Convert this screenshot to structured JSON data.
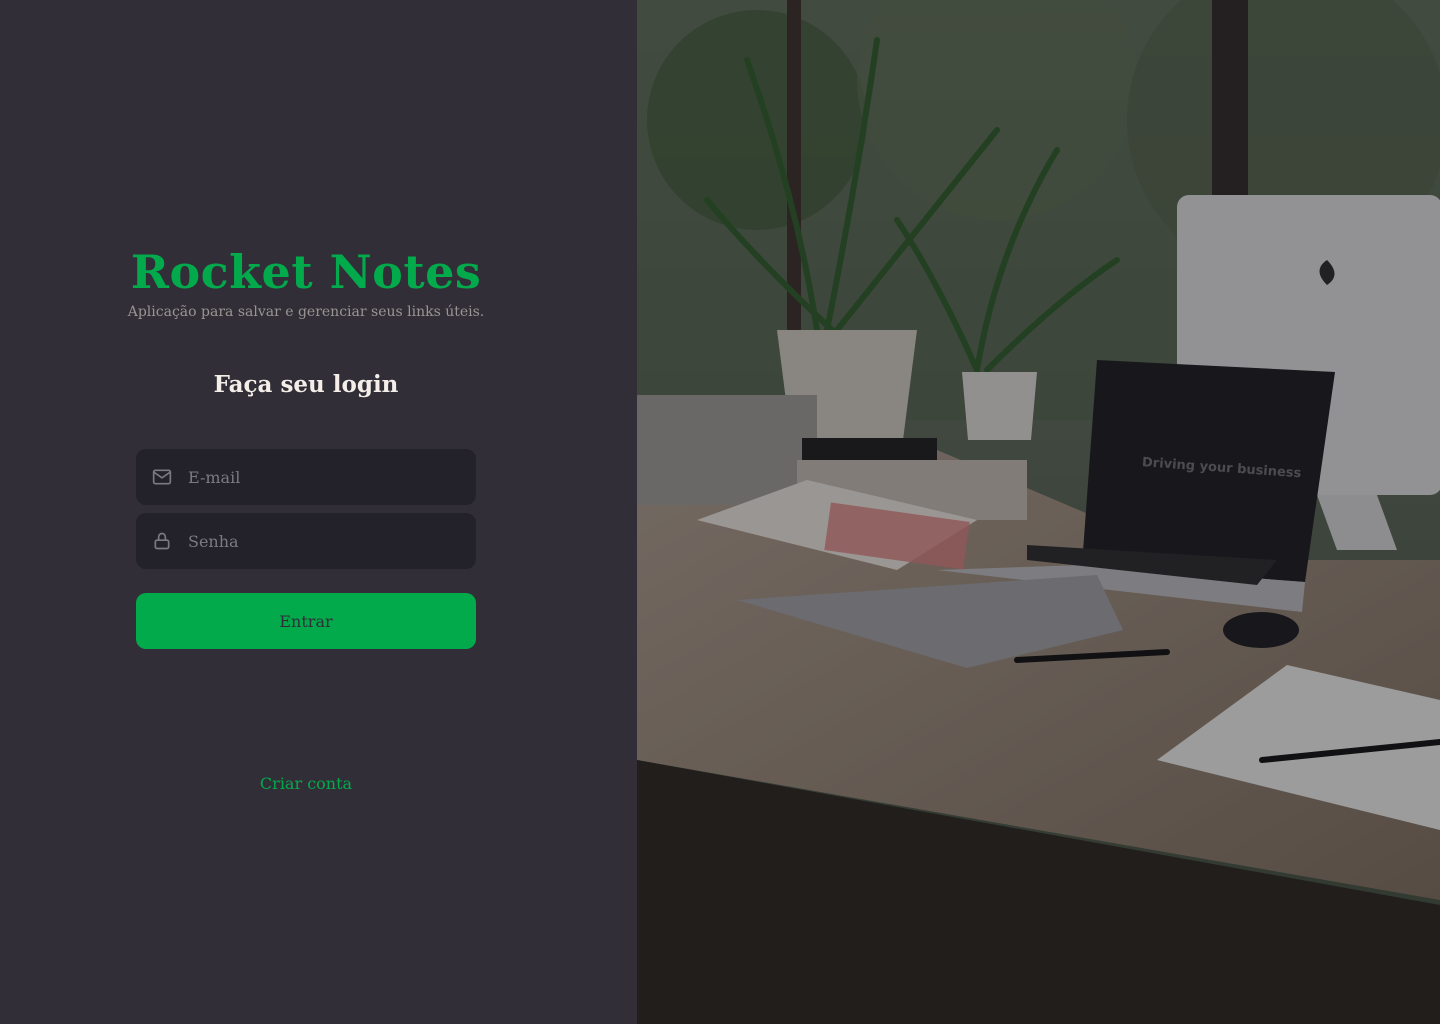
{
  "app": {
    "title": "Rocket Notes",
    "subtitle": "Aplicação para salvar e gerenciar seus links úteis."
  },
  "form": {
    "heading": "Faça seu login",
    "email": {
      "placeholder": "E-mail",
      "value": "",
      "icon": "mail-icon"
    },
    "password": {
      "placeholder": "Senha",
      "value": "",
      "icon": "lock-icon"
    },
    "submit_label": "Entrar",
    "create_account_label": "Criar conta"
  },
  "background_image": {
    "laptop_screen_text": "Driving your business"
  },
  "colors": {
    "background": "#312e38",
    "input_background": "#232129",
    "accent": "#02aa4c",
    "text_primary": "#f4ede8",
    "text_muted": "#999591"
  }
}
